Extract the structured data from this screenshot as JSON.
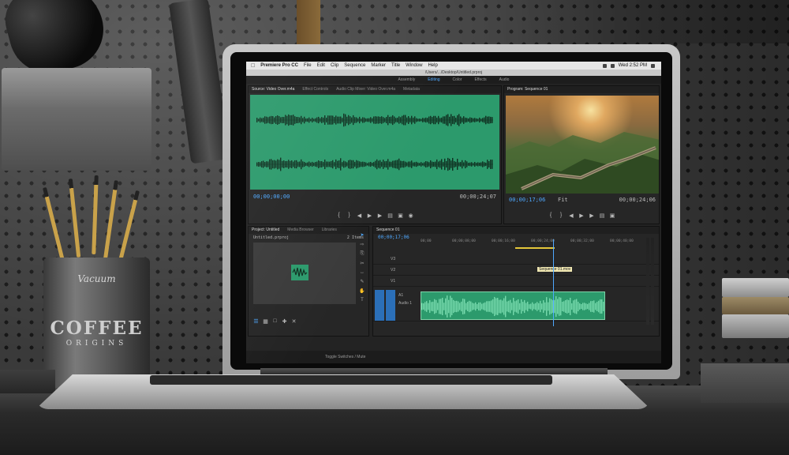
{
  "os_menubar": {
    "app_name": "Premiere Pro CC",
    "items": [
      "File",
      "Edit",
      "Clip",
      "Sequence",
      "Marker",
      "Title",
      "Window",
      "Help"
    ],
    "clock": "Wed 2:52 PM"
  },
  "window": {
    "title": "/Users/.../Desktop/Untitled.prproj"
  },
  "workspaces": {
    "items": [
      "Assembly",
      "Editing",
      "Color",
      "Effects",
      "Audio"
    ],
    "active": "Editing"
  },
  "source_panel": {
    "tabs": [
      "Source: Video Over.m4a",
      "Effect Controls",
      "Audio Clip Mixer: Video Over.m4a",
      "Metadata"
    ],
    "timecode_in": "00;00;00;00",
    "timecode_duration": "00;00;24;07",
    "wave_color": "#2c9a6c"
  },
  "program_panel": {
    "tabs": [
      "Program: Sequence 01"
    ],
    "timecode": "00;00;17;06",
    "fit_label": "Fit",
    "timecode_duration": "00;00;24;06"
  },
  "project_panel": {
    "tabs": [
      "Project: Untitled",
      "Media Browser",
      "Libraries"
    ],
    "path": "Untitled.prproj",
    "item_count": "2 Items"
  },
  "timeline": {
    "tabs": [
      "Sequence 01"
    ],
    "timecode": "00;00;17;06",
    "ruler_labels": [
      "00;00",
      "00;00;08;00",
      "00;00;16;00",
      "00;00;24;00",
      "00;00;32;00",
      "00;00;40;00"
    ],
    "tracks": [
      {
        "name": "V3"
      },
      {
        "name": "V2"
      },
      {
        "name": "V1"
      },
      {
        "name": "A1",
        "label": "Audio 1"
      },
      {
        "name": "A2"
      }
    ],
    "video_clip_label": "Sequence 01.mov",
    "clip_color": "#2c9a6c",
    "accent_color": "#4ea8ff"
  },
  "status_bar": {
    "label": "Toggle Switches / Mute"
  },
  "mug": {
    "brand": "Vacuum",
    "word": "COFFEE",
    "sub": "ORIGINS"
  }
}
